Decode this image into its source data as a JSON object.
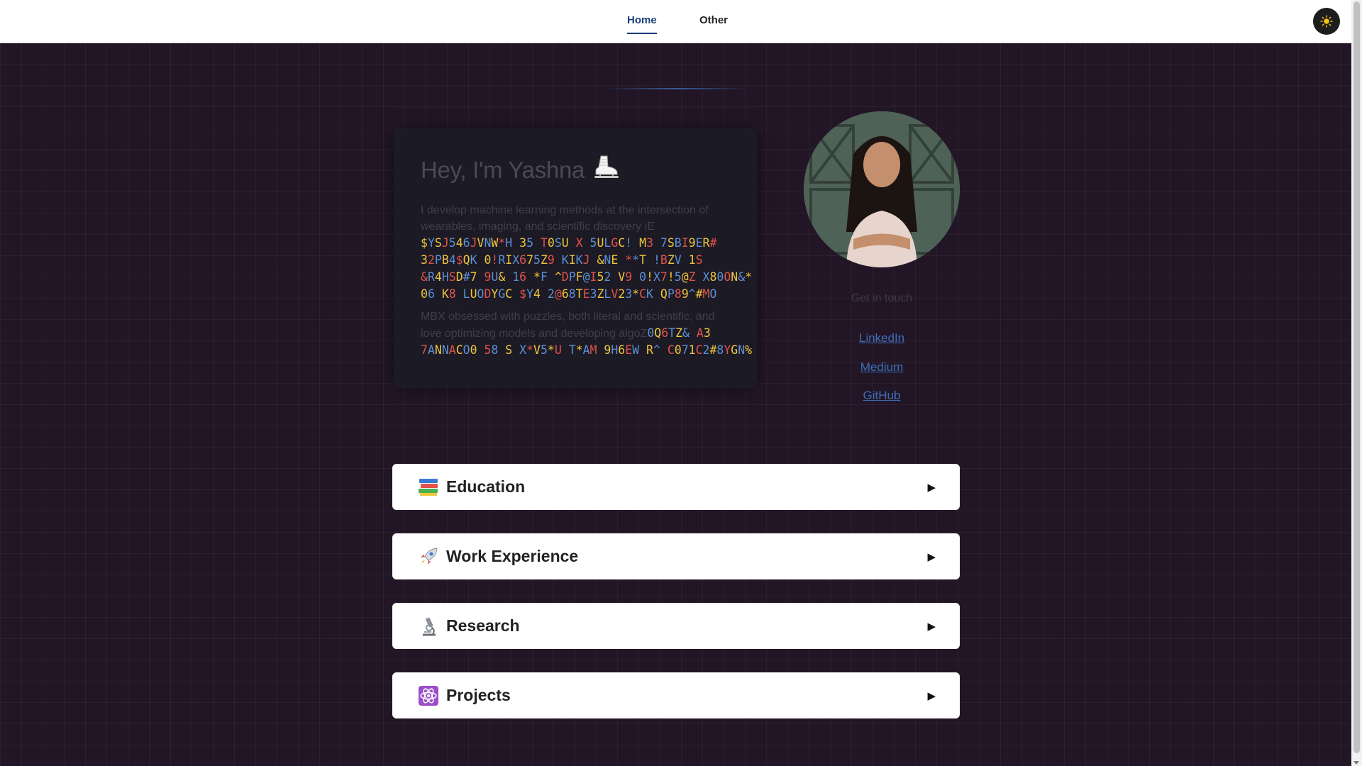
{
  "nav": {
    "home": "Home",
    "other": "Other"
  },
  "theme_toggle_icon": "sun-icon",
  "intro": {
    "title": "Hey, I'm Yashna",
    "title_icon": "ice-skate-icon",
    "text1": "I develop machine learning methods at the intersection of wearables, imaging, and scientific discovery iE",
    "glitch1": [
      "$YSJ546JVNW*H 35 T0SU X 5ULGC! M3 7SBI9ER#",
      "32PB4$QK 0!RIX675Z9 KIKJ &NE **T !BZV 1S",
      "&R4HSD#7 9U& 16 *F ^DPF@I52 V9 0!X7!5@Z X80ON&*",
      "06 K8 LUODYGC $Y4 2@68TE3ZLV23*CK QP89^#MO"
    ],
    "text2": "MBX obsessed with puzzles, both literal and scientific, and love optimizing models and developing algoZ",
    "glitch2a": "0Q6TZ& A3",
    "glitch2b": "7ANNACO0 58 S X*V5*U T*AM 9H6EW R^ C071C2#8YGN%"
  },
  "profile": {
    "get_in_touch": "Get in touch",
    "links": [
      "LinkedIn",
      "Medium",
      "GitHub"
    ]
  },
  "sections": [
    {
      "title": "Education",
      "icon": "books-icon"
    },
    {
      "title": "Work Experience",
      "icon": "rocket-icon"
    },
    {
      "title": "Research",
      "icon": "microscope-icon"
    },
    {
      "title": "Projects",
      "icon": "atom-icon"
    }
  ],
  "colors": {
    "background": "#221626",
    "accent": "#1c3f7a",
    "link": "#3d6db8",
    "glitch_yellow": "#f0c53c",
    "glitch_blue": "#5b8fd8",
    "glitch_red": "#e0524a"
  }
}
